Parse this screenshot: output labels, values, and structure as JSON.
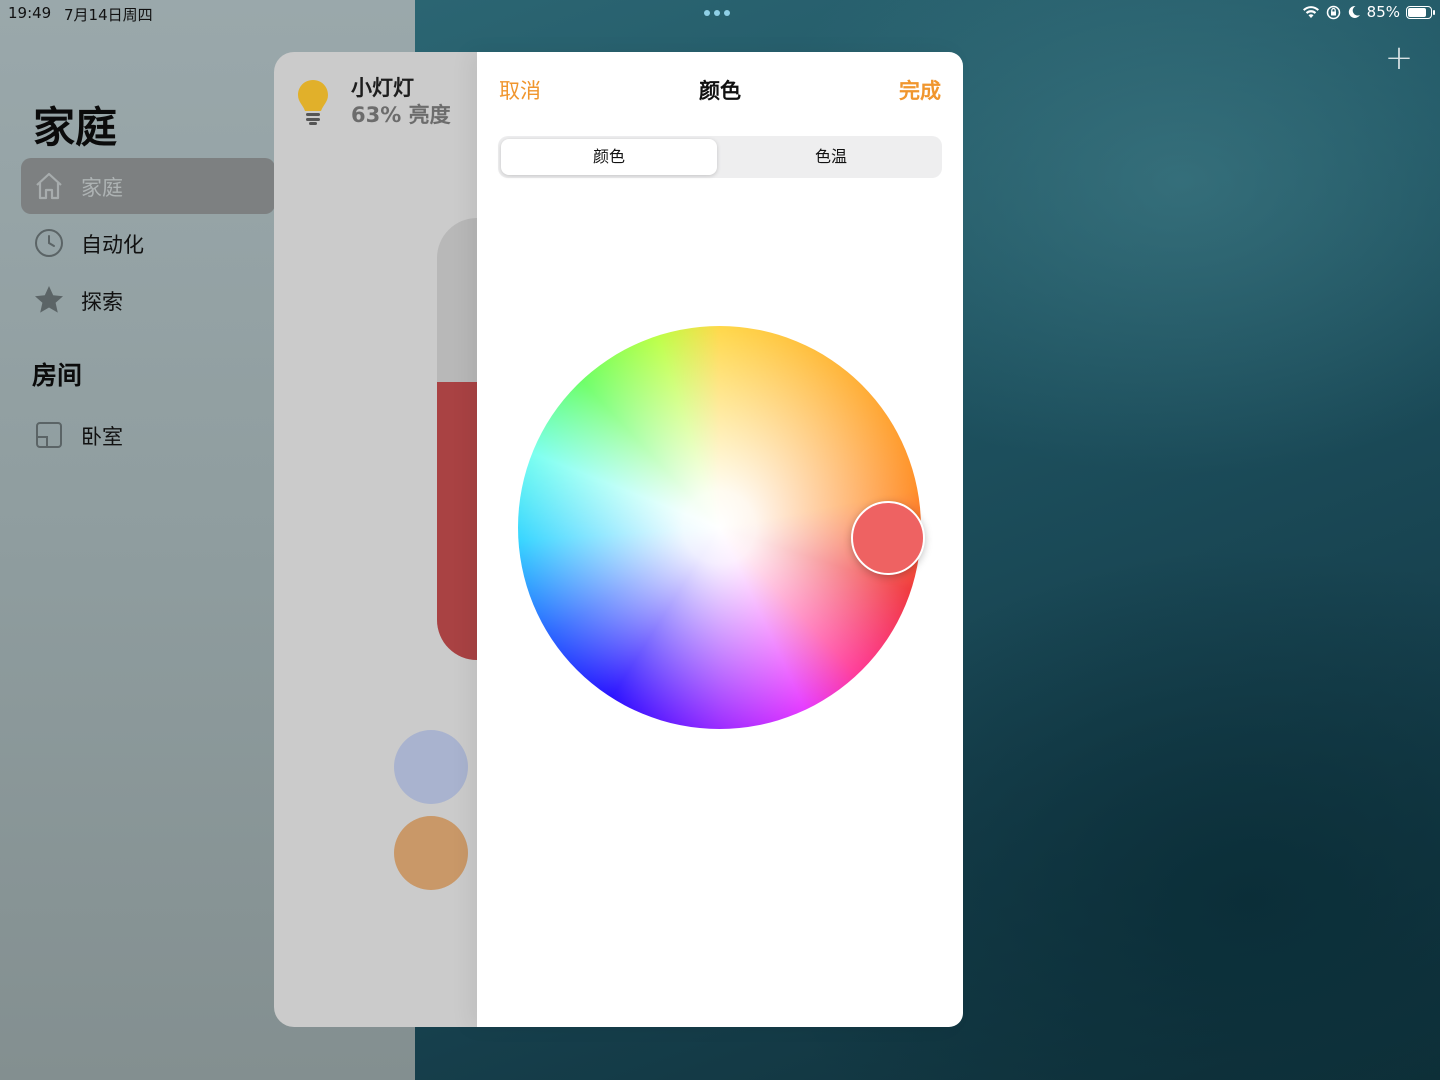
{
  "status_bar": {
    "time": "19:49",
    "date": "7月14日周四",
    "battery": "85%",
    "battery_level": 0.85,
    "icons": [
      "wifi-icon",
      "orientation-lock-icon",
      "moon-icon",
      "battery-icon"
    ]
  },
  "sidebar": {
    "title": "家庭",
    "items": [
      {
        "label": "家庭",
        "icon": "home-icon",
        "selected": true
      },
      {
        "label": "自动化",
        "icon": "clock-icon",
        "selected": false
      },
      {
        "label": "探索",
        "icon": "star-icon",
        "selected": false
      }
    ],
    "rooms_title": "房间",
    "rooms": [
      {
        "label": "卧室",
        "icon": "room-icon"
      }
    ]
  },
  "accessory": {
    "name": "小灯灯",
    "status": "63% 亮度",
    "icon": "lightbulb-icon",
    "brightness": 0.63,
    "brightness_color": "#a94243",
    "presets": [
      {
        "color": "#a9b3cf"
      },
      {
        "color": "#c99868"
      }
    ]
  },
  "color_sheet": {
    "cancel_label": "取消",
    "title": "颜色",
    "done_label": "完成",
    "segments": [
      "颜色",
      "色温"
    ],
    "active_segment": 0,
    "selected_color": "#ee6262",
    "accent_color": "#f0962e"
  },
  "toolbar": {
    "add_label": "+"
  }
}
